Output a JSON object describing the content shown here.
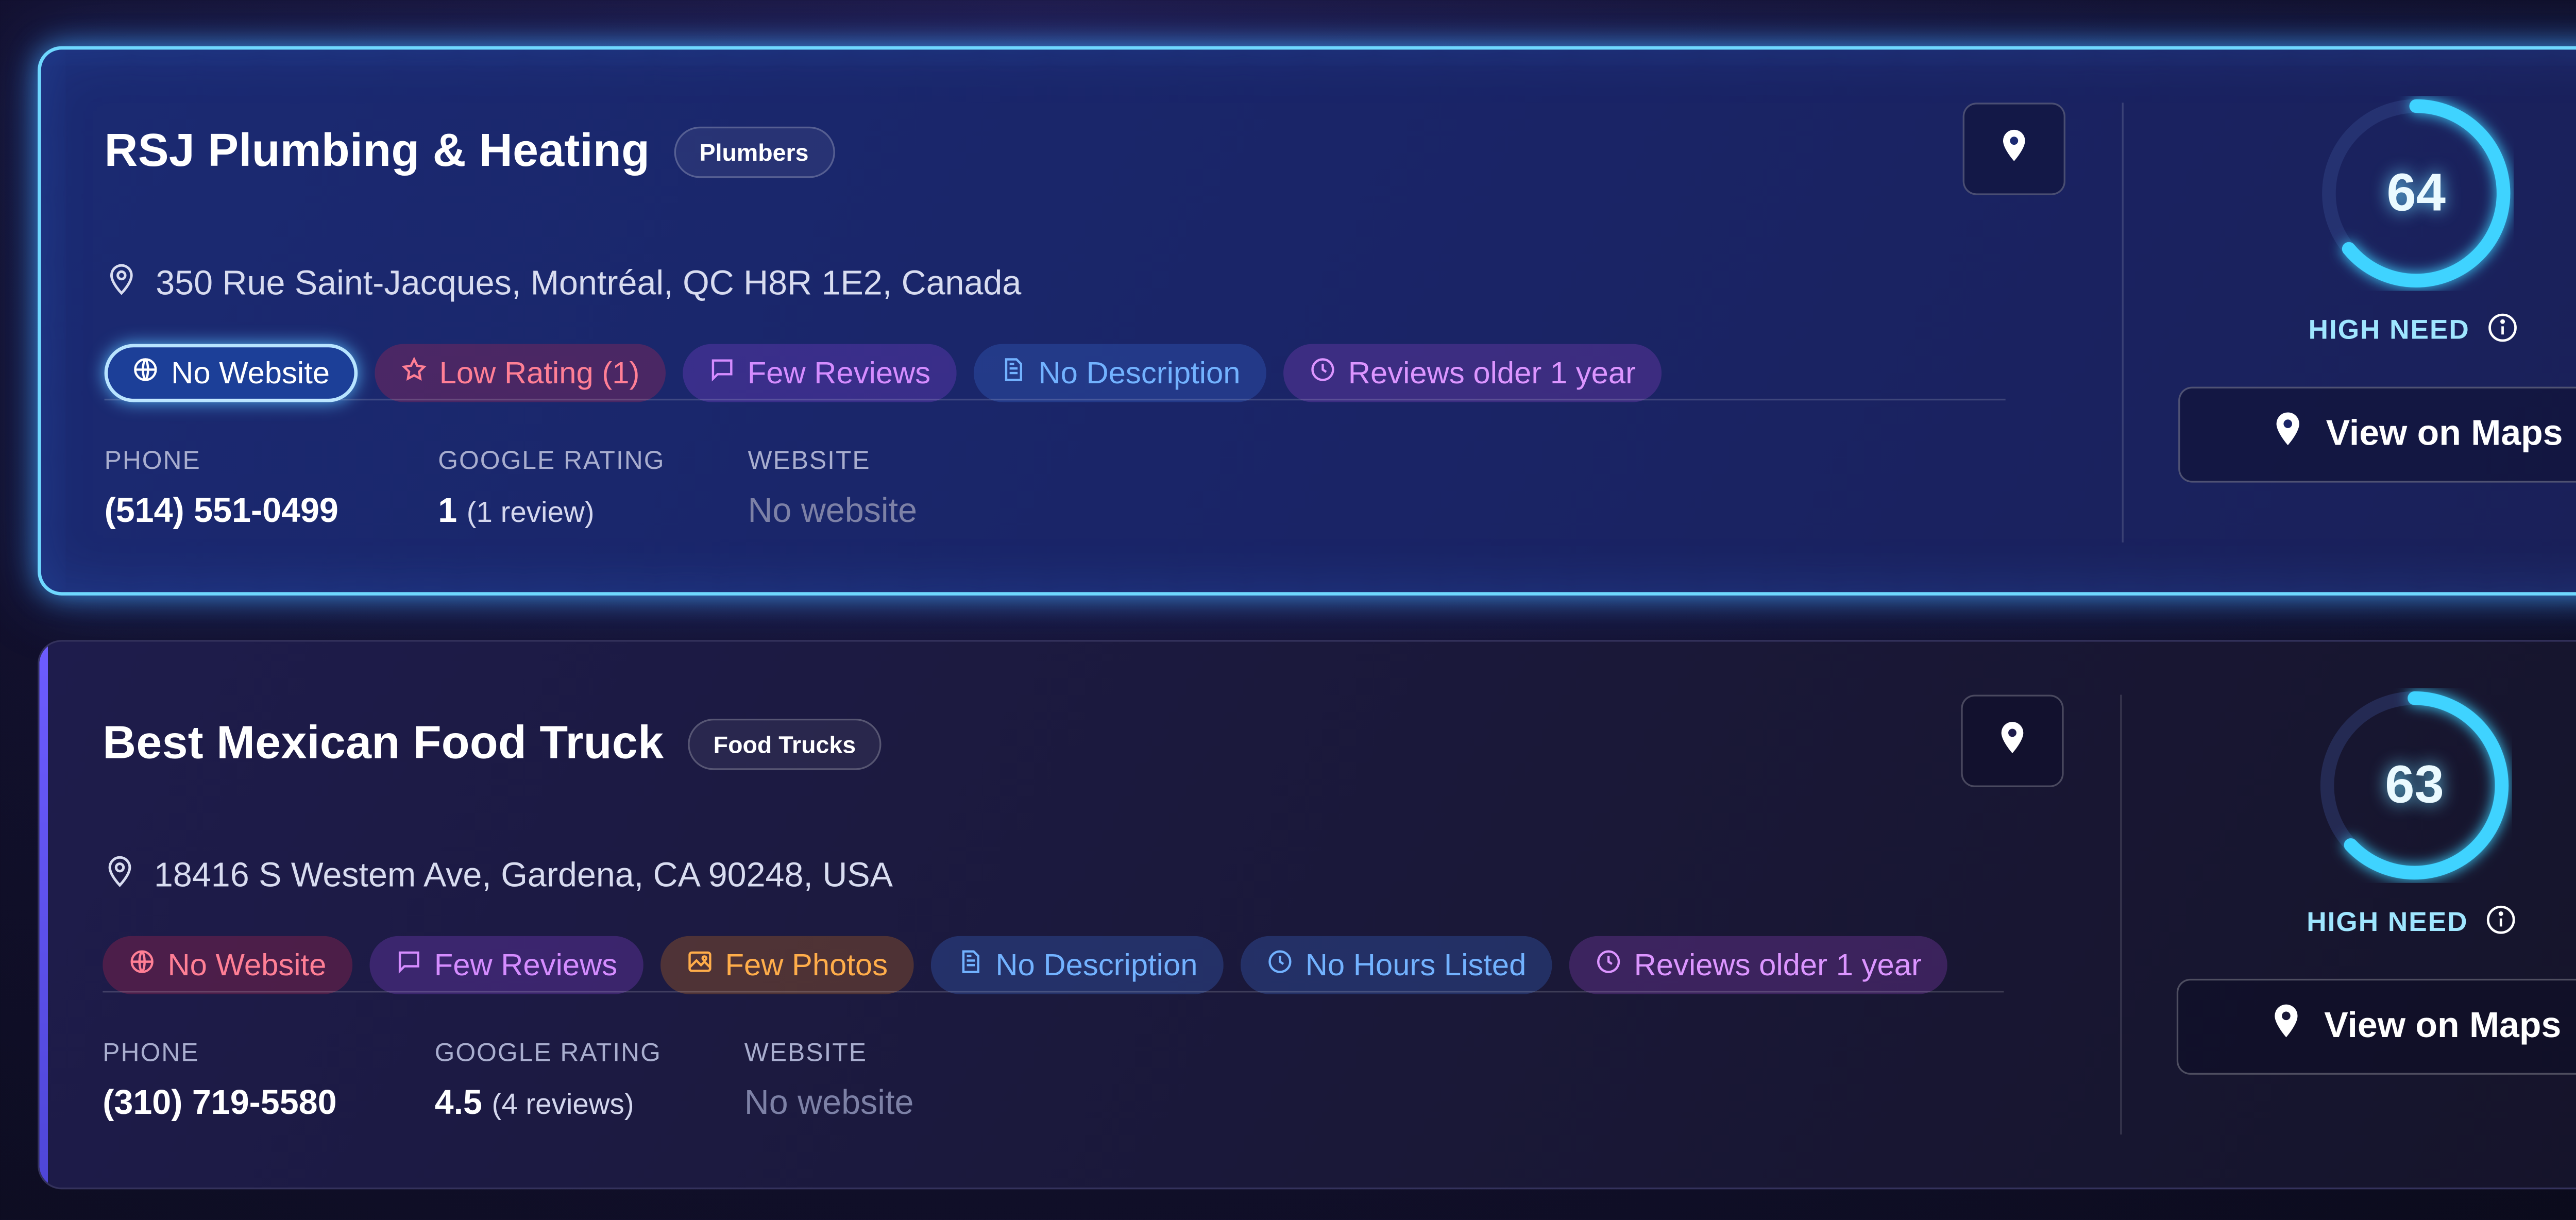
{
  "listings": [
    {
      "name": "RSJ Plumbing & Heating",
      "category": "Plumbers",
      "address": "350 Rue Saint-Jacques, Montréal, QC H8R 1E2, Canada",
      "tags": [
        {
          "label": "No Website",
          "icon": "globe-icon",
          "style": "web-active"
        },
        {
          "label": "Low Rating (1)",
          "icon": "star-icon",
          "style": "red"
        },
        {
          "label": "Few Reviews",
          "icon": "comment-icon",
          "style": "purple"
        },
        {
          "label": "No Description",
          "icon": "document-icon",
          "style": "blue"
        },
        {
          "label": "Reviews older 1 year",
          "icon": "clock-icon",
          "style": "violet"
        }
      ],
      "phone_label": "PHONE",
      "phone": "(514) 551-0499",
      "rating_label": "GOOGLE RATING",
      "rating": "1",
      "rating_reviews": "(1 review)",
      "website_label": "WEBSITE",
      "website": "No website",
      "score": 64,
      "need_label": "HIGH NEED",
      "maps_label": "View on Maps"
    },
    {
      "name": "Best Mexican Food Truck",
      "category": "Food Trucks",
      "address": "18416 S Westem Ave, Gardena, CA 90248, USA",
      "tags": [
        {
          "label": "No Website",
          "icon": "globe-icon",
          "style": "red"
        },
        {
          "label": "Few Reviews",
          "icon": "comment-icon",
          "style": "purple"
        },
        {
          "label": "Few Photos",
          "icon": "image-icon",
          "style": "orange"
        },
        {
          "label": "No Description",
          "icon": "document-icon",
          "style": "blue"
        },
        {
          "label": "No Hours Listed",
          "icon": "clock-icon",
          "style": "blue"
        },
        {
          "label": "Reviews older 1 year",
          "icon": "clock-icon",
          "style": "violet"
        }
      ],
      "phone_label": "PHONE",
      "phone": "(310) 719-5580",
      "rating_label": "GOOGLE RATING",
      "rating": "4.5",
      "rating_reviews": "(4 reviews)",
      "website_label": "WEBSITE",
      "website": "No website",
      "score": 63,
      "need_label": "HIGH NEED",
      "maps_label": "View on Maps"
    }
  ],
  "colors": {
    "score_ring": "#3fd3ff",
    "active_border": "#6fd8ff"
  }
}
